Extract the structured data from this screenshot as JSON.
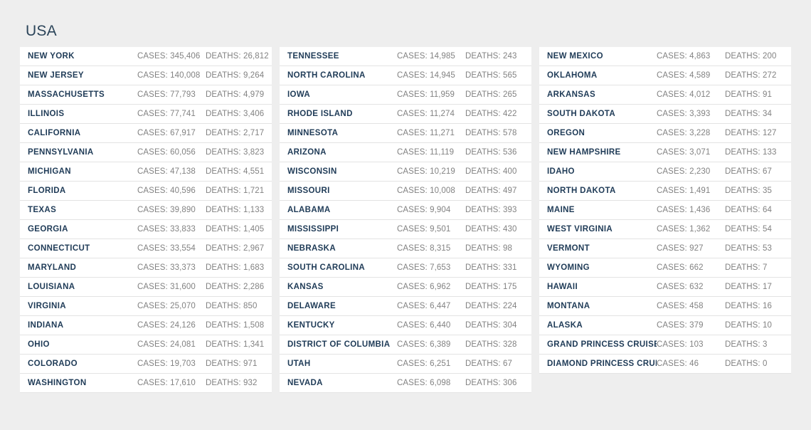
{
  "header": {
    "title": "USA"
  },
  "labels": {
    "cases_prefix": "CASES: ",
    "deaths_prefix": "DEATHS: "
  },
  "colors": {
    "page_background": "#eeeeee",
    "row_background": "#ffffff",
    "state_name_text": "#1f3b57",
    "metric_text": "#828282",
    "title_text": "#2b4459",
    "row_divider": "#e3e3e3"
  },
  "columns": [
    {
      "rows": [
        {
          "state": "NEW YORK",
          "cases": "CASES: 345,406",
          "deaths": "DEATHS: 26,812"
        },
        {
          "state": "NEW JERSEY",
          "cases": "CASES: 140,008",
          "deaths": "DEATHS: 9,264"
        },
        {
          "state": "MASSACHUSETTS",
          "cases": "CASES: 77,793",
          "deaths": "DEATHS: 4,979"
        },
        {
          "state": "ILLINOIS",
          "cases": "CASES: 77,741",
          "deaths": "DEATHS: 3,406"
        },
        {
          "state": "CALIFORNIA",
          "cases": "CASES: 67,917",
          "deaths": "DEATHS: 2,717"
        },
        {
          "state": "PENNSYLVANIA",
          "cases": "CASES: 60,056",
          "deaths": "DEATHS: 3,823"
        },
        {
          "state": "MICHIGAN",
          "cases": "CASES: 47,138",
          "deaths": "DEATHS: 4,551"
        },
        {
          "state": "FLORIDA",
          "cases": "CASES: 40,596",
          "deaths": "DEATHS: 1,721"
        },
        {
          "state": "TEXAS",
          "cases": "CASES: 39,890",
          "deaths": "DEATHS: 1,133"
        },
        {
          "state": "GEORGIA",
          "cases": "CASES: 33,833",
          "deaths": "DEATHS: 1,405"
        },
        {
          "state": "CONNECTICUT",
          "cases": "CASES: 33,554",
          "deaths": "DEATHS: 2,967"
        },
        {
          "state": "MARYLAND",
          "cases": "CASES: 33,373",
          "deaths": "DEATHS: 1,683"
        },
        {
          "state": "LOUISIANA",
          "cases": "CASES: 31,600",
          "deaths": "DEATHS: 2,286"
        },
        {
          "state": "VIRGINIA",
          "cases": "CASES: 25,070",
          "deaths": "DEATHS: 850"
        },
        {
          "state": "INDIANA",
          "cases": "CASES: 24,126",
          "deaths": "DEATHS: 1,508"
        },
        {
          "state": "OHIO",
          "cases": "CASES: 24,081",
          "deaths": "DEATHS: 1,341"
        },
        {
          "state": "COLORADO",
          "cases": "CASES: 19,703",
          "deaths": "DEATHS: 971"
        },
        {
          "state": "WASHINGTON",
          "cases": "CASES: 17,610",
          "deaths": "DEATHS: 932"
        }
      ]
    },
    {
      "rows": [
        {
          "state": "TENNESSEE",
          "cases": "CASES: 14,985",
          "deaths": "DEATHS: 243"
        },
        {
          "state": "NORTH CAROLINA",
          "cases": "CASES: 14,945",
          "deaths": "DEATHS: 565"
        },
        {
          "state": "IOWA",
          "cases": "CASES: 11,959",
          "deaths": "DEATHS: 265"
        },
        {
          "state": "RHODE ISLAND",
          "cases": "CASES: 11,274",
          "deaths": "DEATHS: 422"
        },
        {
          "state": "MINNESOTA",
          "cases": "CASES: 11,271",
          "deaths": "DEATHS: 578"
        },
        {
          "state": "ARIZONA",
          "cases": "CASES: 11,119",
          "deaths": "DEATHS: 536"
        },
        {
          "state": "WISCONSIN",
          "cases": "CASES: 10,219",
          "deaths": "DEATHS: 400"
        },
        {
          "state": "MISSOURI",
          "cases": "CASES: 10,008",
          "deaths": "DEATHS: 497"
        },
        {
          "state": "ALABAMA",
          "cases": "CASES: 9,904",
          "deaths": "DEATHS: 393"
        },
        {
          "state": "MISSISSIPPI",
          "cases": "CASES: 9,501",
          "deaths": "DEATHS: 430"
        },
        {
          "state": "NEBRASKA",
          "cases": "CASES: 8,315",
          "deaths": "DEATHS: 98"
        },
        {
          "state": "SOUTH CAROLINA",
          "cases": "CASES: 7,653",
          "deaths": "DEATHS: 331"
        },
        {
          "state": "KANSAS",
          "cases": "CASES: 6,962",
          "deaths": "DEATHS: 175"
        },
        {
          "state": "DELAWARE",
          "cases": "CASES: 6,447",
          "deaths": "DEATHS: 224"
        },
        {
          "state": "KENTUCKY",
          "cases": "CASES: 6,440",
          "deaths": "DEATHS: 304"
        },
        {
          "state": "DISTRICT OF COLUMBIA",
          "cases": "CASES: 6,389",
          "deaths": "DEATHS: 328"
        },
        {
          "state": "UTAH",
          "cases": "CASES: 6,251",
          "deaths": "DEATHS: 67"
        },
        {
          "state": "NEVADA",
          "cases": "CASES: 6,098",
          "deaths": "DEATHS: 306"
        }
      ]
    },
    {
      "rows": [
        {
          "state": "NEW MEXICO",
          "cases": "CASES: 4,863",
          "deaths": "DEATHS: 200"
        },
        {
          "state": "OKLAHOMA",
          "cases": "CASES: 4,589",
          "deaths": "DEATHS: 272"
        },
        {
          "state": "ARKANSAS",
          "cases": "CASES: 4,012",
          "deaths": "DEATHS: 91"
        },
        {
          "state": "SOUTH DAKOTA",
          "cases": "CASES: 3,393",
          "deaths": "DEATHS: 34"
        },
        {
          "state": "OREGON",
          "cases": "CASES: 3,228",
          "deaths": "DEATHS: 127"
        },
        {
          "state": "NEW HAMPSHIRE",
          "cases": "CASES: 3,071",
          "deaths": "DEATHS: 133"
        },
        {
          "state": "IDAHO",
          "cases": "CASES: 2,230",
          "deaths": "DEATHS: 67"
        },
        {
          "state": "NORTH DAKOTA",
          "cases": "CASES: 1,491",
          "deaths": "DEATHS: 35"
        },
        {
          "state": "MAINE",
          "cases": "CASES: 1,436",
          "deaths": "DEATHS: 64"
        },
        {
          "state": "WEST VIRGINIA",
          "cases": "CASES: 1,362",
          "deaths": "DEATHS: 54"
        },
        {
          "state": "VERMONT",
          "cases": "CASES: 927",
          "deaths": "DEATHS: 53"
        },
        {
          "state": "WYOMING",
          "cases": "CASES: 662",
          "deaths": "DEATHS: 7"
        },
        {
          "state": "HAWAII",
          "cases": "CASES: 632",
          "deaths": "DEATHS: 17"
        },
        {
          "state": "MONTANA",
          "cases": "CASES: 458",
          "deaths": "DEATHS: 16"
        },
        {
          "state": "ALASKA",
          "cases": "CASES: 379",
          "deaths": "DEATHS: 10"
        },
        {
          "state": "GRAND PRINCESS CRUISE",
          "cases": "CASES: 103",
          "deaths": "DEATHS: 3"
        },
        {
          "state": "DIAMOND PRINCESS CRUISE",
          "cases": "CASES: 46",
          "deaths": "DEATHS: 0"
        }
      ]
    }
  ]
}
